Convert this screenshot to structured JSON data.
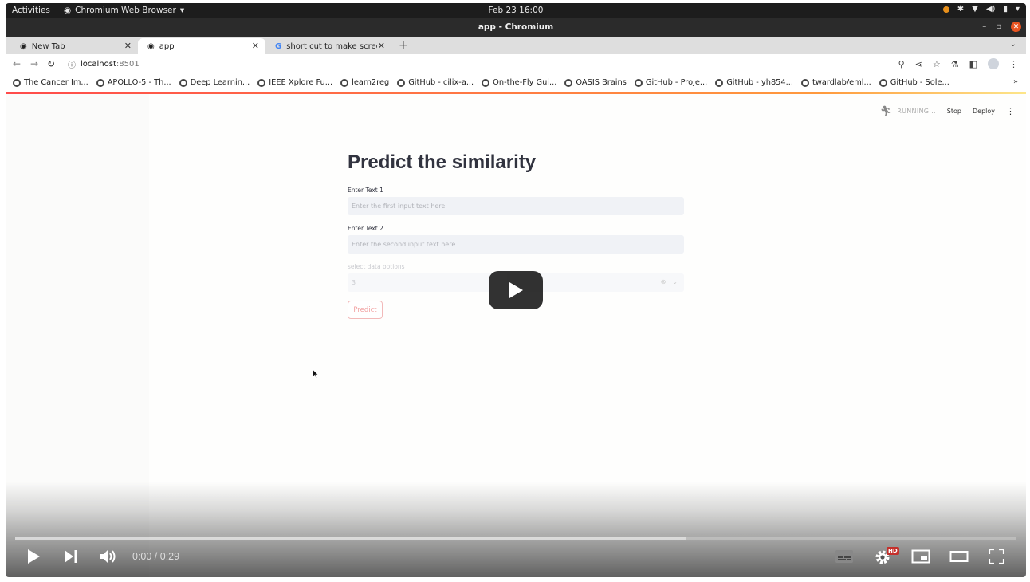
{
  "system_bar": {
    "activities": "Activities",
    "app_name": "Chromium Web Browser",
    "clock": "Feb 23  16:00"
  },
  "window": {
    "title": "app - Chromium"
  },
  "tabs": [
    {
      "label": "New Tab",
      "active": false
    },
    {
      "label": "app",
      "active": true
    },
    {
      "label": "short cut to make screen",
      "active": false
    }
  ],
  "address": {
    "host": "localhost",
    "port": ":8501"
  },
  "bookmarks": [
    {
      "label": "The Cancer Im...",
      "icon": "globe-icon"
    },
    {
      "label": "APOLLO-5 - Th...",
      "icon": "globe-icon"
    },
    {
      "label": "Deep Learnin...",
      "icon": "globe-icon"
    },
    {
      "label": "IEEE Xplore Fu...",
      "icon": "globe-icon"
    },
    {
      "label": "learn2reg",
      "icon": "globe-icon"
    },
    {
      "label": "GitHub - cilix-a...",
      "icon": "github-icon"
    },
    {
      "label": "On-the-Fly Gui...",
      "icon": "globe-icon"
    },
    {
      "label": "OASIS Brains",
      "icon": "globe-icon"
    },
    {
      "label": "GitHub - Proje...",
      "icon": "globe-icon"
    },
    {
      "label": "GitHub - yh854...",
      "icon": "github-icon"
    },
    {
      "label": "twardlab/eml...",
      "icon": "globe-icon"
    },
    {
      "label": "GitHub - Sole...",
      "icon": "globe-icon"
    }
  ],
  "streamlit_header": {
    "status": "RUNNING...",
    "stop": "Stop",
    "deploy": "Deploy"
  },
  "app": {
    "title": "Predict the similarity",
    "text1_label": "Enter Text 1",
    "text1_placeholder": "Enter the first input text here",
    "text2_label": "Enter Text 2",
    "text2_placeholder": "Enter the second input text here",
    "select_label": "select data options",
    "select_value": "3",
    "predict_button": "Predict"
  },
  "video_player": {
    "time": "0:00 / 0:29",
    "progress_loaded_fraction": 0.67,
    "hd_badge": "HD"
  },
  "colors": {
    "streamlit_red": "#ff4b4b",
    "youtube_red": "#c4302b",
    "ubuntu_orange": "#e95420"
  }
}
